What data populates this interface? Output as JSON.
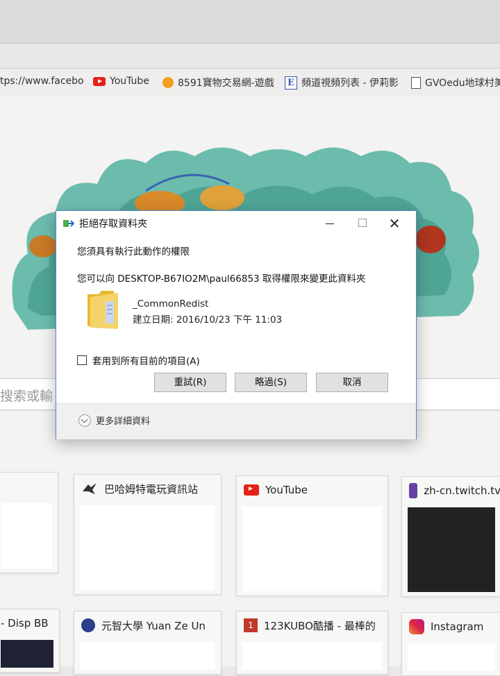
{
  "bookmarks": [
    {
      "label": "tps://www.facebo",
      "icon": "facebook-page-icon"
    },
    {
      "label": "YouTube",
      "icon": "youtube-icon"
    },
    {
      "label": "8591寶物交易網-遊戲",
      "icon": "8591-icon"
    },
    {
      "label": "頻道視頻列表 - 伊莉影",
      "icon": "e-icon"
    },
    {
      "label": "GVOedu地球村美",
      "icon": "page-icon"
    }
  ],
  "search": {
    "placeholder": "搜索或輸"
  },
  "dialog": {
    "title": "拒絕存取資料夾",
    "message_line1": "您須具有執行此動作的權限",
    "message_line2": "您可以向 DESKTOP-B67IO2M\\paul66853 取得權限來變更此資料夾",
    "item_name": "_CommonRedist",
    "item_date": "建立日期: 2016/10/23 下午 11:03",
    "apply_all_label": "套用到所有目前的項目(A)",
    "retry_label": "重試(R)",
    "skip_label": "略過(S)",
    "cancel_label": "取消",
    "more_details_label": "更多詳細資料",
    "close_glyph": "✕"
  },
  "tiles": {
    "bahamut": {
      "title": "巴哈姆特電玩資訊站"
    },
    "youtube": {
      "title": "YouTube"
    },
    "twitch": {
      "title": "zh-cn.twitch.tv"
    },
    "disp": {
      "title": "- Disp BB"
    },
    "yuanze": {
      "title": "元智大學 Yuan Ze Un"
    },
    "kubo": {
      "title": "123KUBO酷播 - 最棒的",
      "icon_text": "1"
    },
    "instagram": {
      "title": "Instagram"
    }
  },
  "colors": {
    "dialog_border": "#5b86c4",
    "youtube_red": "#e62117",
    "twitch_purple": "#6441a4",
    "doodle_teal": "#5fb3a6"
  }
}
